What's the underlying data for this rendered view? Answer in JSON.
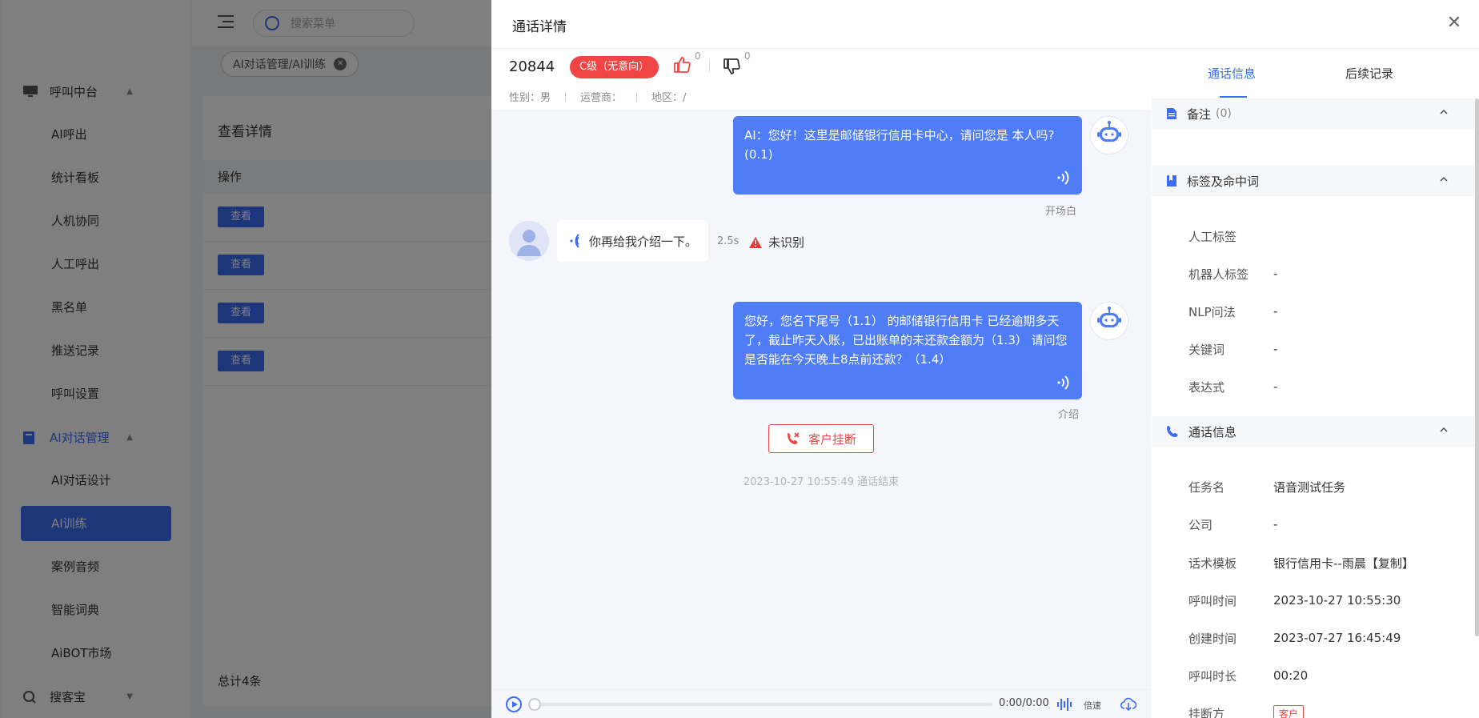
{
  "sidebar": {
    "groups": [
      {
        "label": "呼叫中台",
        "items": [
          "AI呼出",
          "统计看板",
          "人机协同",
          "人工呼出",
          "黑名单",
          "推送记录",
          "呼叫设置"
        ]
      },
      {
        "label": "AI对话管理",
        "items": [
          "AI对话设计",
          "AI训练",
          "案例音频",
          "智能词典",
          "AiBOT市场"
        ]
      },
      {
        "label": "搜客宝",
        "items": []
      }
    ],
    "active_item": "AI训练"
  },
  "topbar": {
    "search_placeholder": "搜索菜单"
  },
  "tab": {
    "label": "AI对话管理/AI训练"
  },
  "bg_page": {
    "title": "查看详情",
    "column": "操作",
    "view_label": "查看",
    "total": "总计4条"
  },
  "drawer": {
    "title": "通话详情",
    "call_id": "20844",
    "grade": "C级（无意向）",
    "likes": "0",
    "dislikes": "0",
    "meta": {
      "gender": "性别：男",
      "carrier": "运营商：",
      "region": "地区：/"
    },
    "messages": [
      {
        "role": "ai",
        "text": "AI：您好！这里是邮储银行信用卡中心，请问您是 本人吗?(0.1)",
        "label": "开场白"
      },
      {
        "role": "user",
        "text": "你再给我介绍一下。",
        "duration": "2.5s",
        "status": "未识别"
      },
      {
        "role": "ai",
        "text": "您好，您名下尾号（1.1） 的邮储银行信用卡 已经逾期多天了，截止昨天入账，已出账单的未还款金额为（1.3） 请问您是否能在今天晚上8点前还款？（1.4）",
        "label": "介绍"
      }
    ],
    "hangup_label": "客户挂断",
    "end_text": "2023-10-27 10:55:49 通话结束",
    "player": {
      "time": "0:00/0:00",
      "speed": "倍速"
    }
  },
  "info": {
    "tabs": [
      "通话信息",
      "后续记录"
    ],
    "notes": {
      "title": "备注",
      "count": "(0)"
    },
    "tags": {
      "title": "标签及命中词",
      "rows": [
        {
          "k": "人工标签",
          "v": ""
        },
        {
          "k": "机器人标签",
          "v": "-"
        },
        {
          "k": "NLP问法",
          "v": "-"
        },
        {
          "k": "关键词",
          "v": "-"
        },
        {
          "k": "表达式",
          "v": "-"
        }
      ]
    },
    "call": {
      "title": "通话信息",
      "rows": [
        {
          "k": "任务名",
          "v": "语音测试任务"
        },
        {
          "k": "公司",
          "v": "-"
        },
        {
          "k": "话术模板",
          "v": "银行信用卡--雨晨【复制】"
        },
        {
          "k": "呼叫时间",
          "v": "2023-10-27 10:55:30"
        },
        {
          "k": "创建时间",
          "v": "2023-07-27 16:45:49"
        },
        {
          "k": "呼叫时长",
          "v": "00:20"
        },
        {
          "k": "挂断方",
          "v": "客户"
        }
      ]
    }
  },
  "colors": {
    "accent": "#3b6cf5",
    "danger": "#ef4545",
    "bubble": "#4f7cf7"
  }
}
